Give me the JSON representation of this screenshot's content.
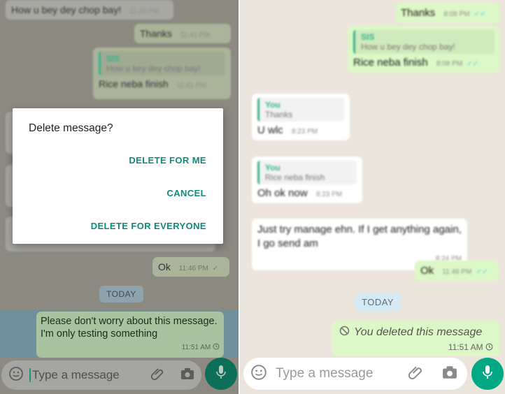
{
  "left": {
    "messages": {
      "m1": {
        "text": "How u bey dey chop bay!",
        "time": "11:40 PM"
      },
      "m2": {
        "text": "Thanks",
        "time": "11:41 PM"
      },
      "m3": {
        "quote_name": "SIS",
        "quote_text": "How u bey dey chop bay!",
        "text": "Rice neba finish",
        "time": "11:41 PM"
      },
      "ok": {
        "text": "Ok",
        "time": "11:46 PM"
      }
    },
    "today_label": "TODAY",
    "selected_message": {
      "text": "Please don't worry about this message. I'm only testing something",
      "time": "11:51 AM"
    },
    "input_placeholder": "Type a message",
    "dialog": {
      "title": "Delete message?",
      "delete_for_me": "DELETE FOR ME",
      "cancel": "CANCEL",
      "delete_for_everyone": "DELETE FOR EVERYONE"
    }
  },
  "right": {
    "messages": {
      "thanks": {
        "text": "Thanks",
        "time": "8:08 PM"
      },
      "rice": {
        "quote_name": "SIS",
        "quote_text": "How u bey dey chop bay!",
        "text": "Rice neba finish",
        "time": "8:08 PM"
      },
      "uwlc": {
        "quote_name": "You",
        "quote_text": "Thanks",
        "text": "U wlc",
        "time": "8:23 PM"
      },
      "ohok": {
        "quote_name": "You",
        "quote_text": "Rice neba finish",
        "text": "Oh ok now",
        "time": "8:23 PM"
      },
      "justtry": {
        "text": "Just try manage ehn. If I get anything again, I go send am",
        "time": "8:24 PM"
      },
      "ok": {
        "text": "Ok",
        "time": "11:46 PM"
      }
    },
    "today_label": "TODAY",
    "deleted_message": {
      "text": "You deleted this message",
      "time": "11:51 AM"
    },
    "input_placeholder": "Type a message"
  },
  "colors": {
    "accent": "#0e8a7a",
    "outgoing_bubble": "#dcf8c6",
    "incoming_bubble": "#ffffff",
    "mic_button": "#00a884",
    "chat_background": "#ece5dc"
  },
  "icons": [
    "emoji-icon",
    "attach-icon",
    "camera-icon",
    "mic-icon",
    "blocked-icon",
    "clock-icon",
    "double-check-icon"
  ]
}
